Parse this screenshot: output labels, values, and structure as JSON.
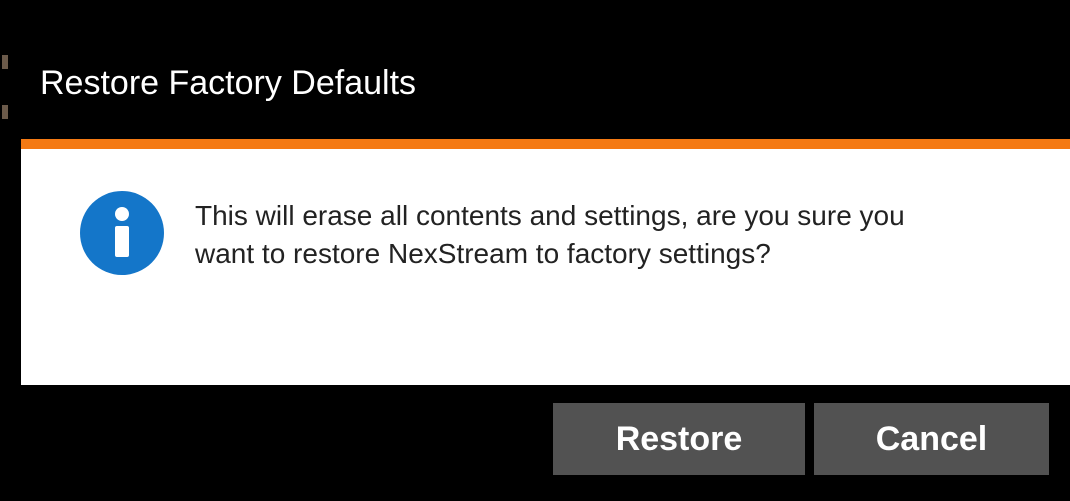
{
  "dialog": {
    "title": "Restore Factory Defaults",
    "message": "This will erase all contents and settings, are you sure you want to restore NexStream to factory settings?",
    "icon": "info-icon",
    "accent_color": "#f47a14",
    "icon_color": "#1476c9",
    "buttons": {
      "restore_label": "Restore",
      "cancel_label": "Cancel"
    }
  }
}
